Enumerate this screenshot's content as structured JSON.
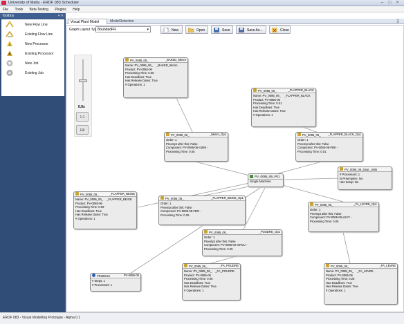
{
  "window": {
    "title": "University of Malta - ERDF 083 Scheduler"
  },
  "menu": [
    "File",
    "Tools",
    "Beta Testing",
    "Plugins",
    "Help"
  ],
  "toolbox": {
    "title": "Toolbox",
    "pin": "▾ ✕",
    "items": [
      {
        "label": "New Flow Line",
        "icon": "flow-line-new-icon"
      },
      {
        "label": "Existing Flow Line",
        "icon": "flow-line-existing-icon"
      },
      {
        "label": "New Processor",
        "icon": "processor-new-icon"
      },
      {
        "label": "Existing Processor",
        "icon": "processor-existing-icon"
      },
      {
        "label": "New Job",
        "icon": "job-new-icon"
      },
      {
        "label": "Existing Job",
        "icon": "job-existing-icon"
      }
    ]
  },
  "tabs": [
    {
      "label": "Visual Plant Model"
    },
    {
      "label": "ModelDetection"
    }
  ],
  "toolbar": {
    "layout_label": "Graph Layout Type:",
    "layout_value": "BoundedFR",
    "buttons": [
      {
        "label": "New"
      },
      {
        "label": "Open"
      },
      {
        "label": "Save"
      },
      {
        "label": "Save As..."
      },
      {
        "label": "Close"
      }
    ]
  },
  "zoom": {
    "value": "0.9x",
    "fit_label": "1:1",
    "fill_label": "Fill"
  },
  "nodes": {
    "job_top": {
      "t1": "PV_0085_06_",
      "t2": "_BAKED_5kmm",
      "lines": [
        "Name: PV_0085_06_",
        "Product: PV-0085-06",
        "Processing Time: 0.05",
        "Has Deadlines: True",
        "Has Release Dates: True",
        "# Operations: 1"
      ],
      "mid": "_BAKED_5kmm"
    },
    "job_flapper_black": {
      "t1": "PV_0085_06_",
      "t2": "_FLAPPER_BLACK",
      "lines": [
        "Name: PV_0085_06_",
        "Product: PV-0085-06",
        "Processing Time: 0.01",
        "Has Deadlines: True",
        "Has Release Dates: True",
        "# Operations: 1"
      ],
      "mid": "_FLAPPER_BLACK"
    },
    "op_5kmm": {
      "t1": "PV_0085_06_",
      "t2": "_5kmm_Op1",
      "lines": [
        "Order: 1",
        "Preempt after this: False",
        "Component: PV-0085-06-4,859 -",
        "Processing Time: 0.05"
      ]
    },
    "op_flapper_black": {
      "t1": "PV_0085_06_",
      "t2": "_FLAPPER_BLACK_Op1",
      "lines": [
        "Order: 1",
        "Preempt after this: False",
        "Component: PV-0085-06-FBK -",
        "Processing Time: 0.01"
      ]
    },
    "dept": {
      "t1": "PV_0085_06_Dept_Units",
      "t2": "",
      "lines": [
        "# Processors: 1",
        "Is Preemptive: No",
        "Has Setup: No"
      ]
    },
    "machine": {
      "t1": "PV_0085_06_P01",
      "t2": "",
      "lines": [
        "Single Machine"
      ]
    },
    "job_flapper_beige": {
      "t1": "PV_0085_06_",
      "t2": "_FLAPPER_BEIGE",
      "lines": [
        "Name: PV_0085_06_",
        "Product: PV-0085-06",
        "Processing Time: 0.09",
        "Has Deadlines: True",
        "Has Release Dates: True",
        "# Operations: 1"
      ],
      "mid": "_FLAPPER_BEIGE"
    },
    "op_flapper_beige": {
      "t1": "PV_0085_06_",
      "t2": "_FLAPPER_BEIGE_Op1",
      "lines": [
        "Order: 1",
        "Preempt after this: False",
        "Component: PV-0085-06-FBG -",
        "Processing Time: 0.25"
      ]
    },
    "op_fa_levre": {
      "t1": "PV_0085_06_",
      "t2": "_FA_LEVRE_Op1",
      "lines": [
        "Order: 1",
        "Preempt after this: False",
        "Component: PV-0085-06-LEVY -",
        "Processing Time: 0.05"
      ]
    },
    "op_poudre": {
      "t1": "PV_0085_06_",
      "t2": "_POUDRE_Op1",
      "lines": [
        "Order: 1",
        "Preempt after this: False",
        "Component: PV-0085-06-GPOU -",
        "Processing Time: 0.05"
      ]
    },
    "product": {
      "t1": "PRODUIS",
      "t2": "PV-0085-06",
      "lines": [
        "# Steps: 1",
        "# Processors: 1"
      ]
    },
    "job_fa_poudre": {
      "t1": "PV_0085_06_",
      "t2": "_FA_POUDRE",
      "lines": [
        "Name: PV_0085_06_",
        "Product: PV-0085-06",
        "Processing Time: 0.05",
        "Has Deadlines: True",
        "Has Release Dates: True",
        "# Operations: 1"
      ],
      "mid": "_FA_POUDRE"
    },
    "job_fa_levre": {
      "t1": "PV_0085_06_",
      "t2": "_FA_LEVRE",
      "lines": [
        "Name: PV_0085_06_",
        "Product: PV-0085-06",
        "Processing Time: 0.25",
        "Has Deadlines: True",
        "Has Release Dates: True",
        "# Operations: 1"
      ],
      "mid": "_FA_LEVRE"
    }
  },
  "status": {
    "text": "ERDF 083 - Visual Modelling Prototype - Alpha 0.1"
  },
  "colors": {
    "toolbox_bg": "#2f4d77",
    "node_bg": "#ebebeb",
    "edge": "#9a9a9a"
  }
}
